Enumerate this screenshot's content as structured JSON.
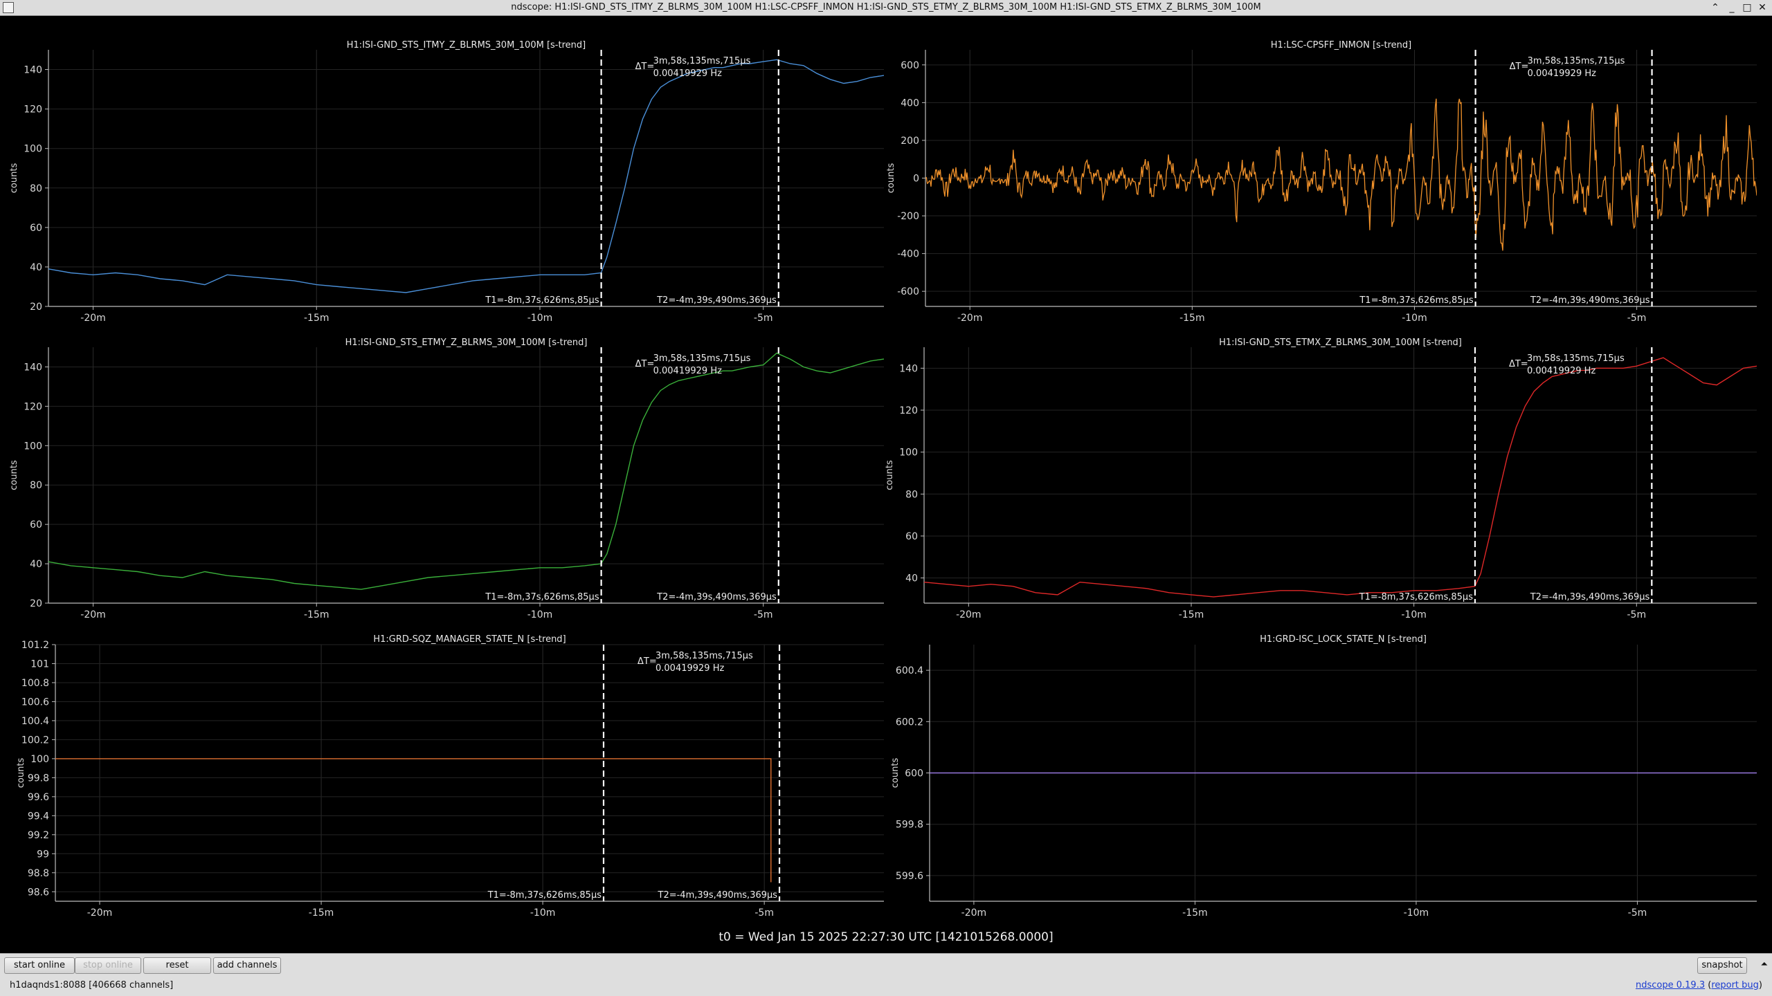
{
  "window": {
    "title": "ndscope: H1:ISI-GND_STS_ITMY_Z_BLRMS_30M_100M H1:LSC-CPSFF_INMON H1:ISI-GND_STS_ETMY_Z_BLRMS_30M_100M H1:ISI-GND_STS_ETMX_Z_BLRMS_30M_100M",
    "minimize": "_",
    "maximize": "□",
    "close": "✕"
  },
  "cursor": {
    "dt_prefix": "ΔT=",
    "dt": "3m,58s,135ms,715μs",
    "freq": "0.00419929 Hz",
    "t1_label": "T1=-8m,37s,626ms,85μs",
    "t2_label": "T2=-4m,39s,490ms,369μs",
    "t1_min": -8.627,
    "t2_min": -4.658
  },
  "colors": {
    "itmy": "#4a8fd8",
    "cpsff": "#f0912a",
    "etmy": "#3ab03a",
    "etmx": "#e02828",
    "sqz": "#e07030",
    "isc": "#9878e0",
    "cursor": "#ffffff"
  },
  "x_ticks": [
    {
      "v": -20,
      "label": "-20m"
    },
    {
      "v": -15,
      "label": "-15m"
    },
    {
      "v": -10,
      "label": "-10m"
    },
    {
      "v": -5,
      "label": "-5m"
    }
  ],
  "plots": [
    {
      "name": "plot-itmy",
      "title": "H1:ISI-GND_STS_ITMY_Z_BLRMS_30M_100M [s-trend]",
      "ylabel": "counts",
      "color_key": "itmy",
      "ylim": [
        20,
        150
      ],
      "ticks": [
        20,
        40,
        60,
        80,
        100,
        120,
        140
      ],
      "cursors": true
    },
    {
      "name": "plot-cpsff",
      "title": "H1:LSC-CPSFF_INMON [s-trend]",
      "ylabel": "counts",
      "color_key": "cpsff",
      "ylim": [
        -680,
        680
      ],
      "ticks": [
        -600,
        -400,
        -200,
        0,
        200,
        400,
        600
      ],
      "cursors": true
    },
    {
      "name": "plot-etmy",
      "title": "H1:ISI-GND_STS_ETMY_Z_BLRMS_30M_100M [s-trend]",
      "ylabel": "counts",
      "color_key": "etmy",
      "ylim": [
        20,
        150
      ],
      "ticks": [
        20,
        40,
        60,
        80,
        100,
        120,
        140
      ],
      "cursors": true
    },
    {
      "name": "plot-etmx",
      "title": "H1:ISI-GND_STS_ETMX_Z_BLRMS_30M_100M [s-trend]",
      "ylabel": "counts",
      "color_key": "etmx",
      "ylim": [
        28,
        150
      ],
      "ticks": [
        40,
        60,
        80,
        100,
        120,
        140
      ],
      "cursors": true
    },
    {
      "name": "plot-sqz",
      "title": "H1:GRD-SQZ_MANAGER_STATE_N [s-trend]",
      "ylabel": "counts",
      "color_key": "sqz",
      "ylim": [
        98.5,
        101.2
      ],
      "ticks": [
        98.6,
        98.8,
        99,
        99.2,
        99.4,
        99.6,
        99.8,
        100,
        100.2,
        100.4,
        100.6,
        100.8,
        101,
        101.2
      ],
      "cursors": true
    },
    {
      "name": "plot-isc",
      "title": "H1:GRD-ISC_LOCK_STATE_N [s-trend]",
      "ylabel": "counts",
      "color_key": "isc",
      "ylim": [
        599.5,
        600.5
      ],
      "ticks": [
        599.6,
        599.8,
        600,
        600.2,
        600.4
      ],
      "cursors": false
    }
  ],
  "chart_data": [
    {
      "type": "line",
      "title": "H1:ISI-GND_STS_ITMY_Z_BLRMS_30M_100M [s-trend]",
      "ylabel": "counts",
      "xlim": [
        -21,
        -2.3
      ],
      "ylim": [
        20,
        150
      ],
      "x": [
        -21,
        -20.5,
        -20,
        -19.5,
        -19,
        -18.5,
        -18,
        -17.5,
        -17,
        -16.5,
        -16,
        -15.5,
        -15,
        -14.5,
        -14,
        -13.5,
        -13,
        -12.5,
        -12,
        -11.5,
        -11,
        -10.5,
        -10,
        -9.5,
        -9,
        -8.63,
        -8.5,
        -8.3,
        -8.1,
        -7.9,
        -7.7,
        -7.5,
        -7.3,
        -7.1,
        -6.9,
        -6.7,
        -6.5,
        -6.3,
        -6.1,
        -5.9,
        -5.7,
        -5.5,
        -5.3,
        -5,
        -4.7,
        -4.4,
        -4.1,
        -3.8,
        -3.5,
        -3.2,
        -2.9,
        -2.6,
        -2.3
      ],
      "series": [
        {
          "values": [
            39,
            37,
            36,
            37,
            36,
            34,
            33,
            31,
            36,
            35,
            34,
            33,
            31,
            30,
            29,
            28,
            27,
            29,
            31,
            33,
            34,
            35,
            36,
            36,
            36,
            37,
            45,
            62,
            80,
            100,
            115,
            125,
            131,
            134,
            136,
            138,
            139,
            140,
            141,
            141,
            142,
            143,
            143,
            144,
            145,
            143,
            142,
            138,
            135,
            133,
            134,
            136,
            137
          ]
        }
      ]
    },
    {
      "type": "line",
      "title": "H1:LSC-CPSFF_INMON [s-trend]",
      "ylabel": "counts",
      "xlim": [
        -21,
        -2.3
      ],
      "ylim": [
        -680,
        680
      ],
      "x": [
        -21,
        -20.5,
        -20,
        -19.5,
        -19,
        -18.5,
        -18,
        -17.5,
        -17,
        -16.5,
        -16,
        -15.5,
        -15,
        -14.5,
        -14,
        -13.5,
        -13,
        -12.5,
        -12,
        -11.5,
        -11,
        -10.5,
        -10,
        -9.5,
        -9,
        -8.5,
        -8,
        -7.5,
        -7,
        -6.5,
        -6,
        -5.5,
        -5,
        -4.5,
        -4,
        -3.5,
        -3,
        -2.5
      ],
      "series": [
        {
          "values": [
            0,
            -80,
            60,
            -100,
            120,
            -50,
            80,
            -120,
            90,
            -60,
            150,
            -120,
            110,
            -80,
            180,
            -160,
            200,
            -140,
            180,
            -220,
            280,
            -260,
            320,
            -380,
            440,
            -500,
            420,
            -360,
            460,
            -380,
            440,
            -420,
            360,
            -300,
            400,
            -280,
            300,
            -250
          ]
        }
      ]
    },
    {
      "type": "line",
      "title": "H1:ISI-GND_STS_ETMY_Z_BLRMS_30M_100M [s-trend]",
      "ylabel": "counts",
      "xlim": [
        -21,
        -2.3
      ],
      "ylim": [
        20,
        150
      ],
      "x": [
        -21,
        -20.5,
        -20,
        -19.5,
        -19,
        -18.5,
        -18,
        -17.5,
        -17,
        -16.5,
        -16,
        -15.5,
        -15,
        -14.5,
        -14,
        -13.5,
        -13,
        -12.5,
        -12,
        -11.5,
        -11,
        -10.5,
        -10,
        -9.5,
        -9,
        -8.63,
        -8.5,
        -8.3,
        -8.1,
        -7.9,
        -7.7,
        -7.5,
        -7.3,
        -7.1,
        -6.9,
        -6.7,
        -6.5,
        -6.3,
        -6.1,
        -5.9,
        -5.7,
        -5.5,
        -5.3,
        -5,
        -4.7,
        -4.4,
        -4.1,
        -3.8,
        -3.5,
        -3.2,
        -2.9,
        -2.6,
        -2.3
      ],
      "series": [
        {
          "values": [
            41,
            39,
            38,
            37,
            36,
            34,
            33,
            36,
            34,
            33,
            32,
            30,
            29,
            28,
            27,
            29,
            31,
            33,
            34,
            35,
            36,
            37,
            38,
            38,
            39,
            40,
            45,
            60,
            80,
            100,
            113,
            122,
            128,
            131,
            133,
            134,
            135,
            136,
            137,
            138,
            138,
            139,
            140,
            141,
            147,
            144,
            140,
            138,
            137,
            139,
            141,
            143,
            144
          ]
        }
      ]
    },
    {
      "type": "line",
      "title": "H1:ISI-GND_STS_ETMX_Z_BLRMS_30M_100M [s-trend]",
      "ylabel": "counts",
      "xlim": [
        -21,
        -2.3
      ],
      "ylim": [
        28,
        150
      ],
      "x": [
        -21,
        -20.5,
        -20,
        -19.5,
        -19,
        -18.5,
        -18,
        -17.5,
        -17,
        -16.5,
        -16,
        -15.5,
        -15,
        -14.5,
        -14,
        -13.5,
        -13,
        -12.5,
        -12,
        -11.5,
        -11,
        -10.5,
        -10,
        -9.5,
        -9,
        -8.63,
        -8.5,
        -8.3,
        -8.1,
        -7.9,
        -7.7,
        -7.5,
        -7.3,
        -7.1,
        -6.9,
        -6.7,
        -6.5,
        -6.3,
        -6.1,
        -5.9,
        -5.7,
        -5.5,
        -5.3,
        -5,
        -4.7,
        -4.4,
        -4.1,
        -3.8,
        -3.5,
        -3.2,
        -2.9,
        -2.6,
        -2.3
      ],
      "series": [
        {
          "values": [
            38,
            37,
            36,
            37,
            36,
            33,
            32,
            38,
            37,
            36,
            35,
            33,
            32,
            31,
            32,
            33,
            34,
            34,
            33,
            32,
            33,
            33,
            34,
            34,
            35,
            36,
            42,
            60,
            80,
            98,
            112,
            122,
            129,
            133,
            136,
            137,
            138,
            139,
            139,
            140,
            140,
            140,
            140,
            141,
            143,
            145,
            141,
            137,
            133,
            132,
            136,
            140,
            141
          ]
        }
      ]
    },
    {
      "type": "line",
      "title": "H1:GRD-SQZ_MANAGER_STATE_N [s-trend]",
      "ylabel": "counts",
      "xlim": [
        -21,
        -2.3
      ],
      "ylim": [
        98.5,
        101.2
      ],
      "x": [
        -21,
        -4.85,
        -4.85
      ],
      "series": [
        {
          "values": [
            100,
            100,
            98.7
          ]
        }
      ]
    },
    {
      "type": "line",
      "title": "H1:GRD-ISC_LOCK_STATE_N [s-trend]",
      "ylabel": "counts",
      "xlim": [
        -21,
        -2.3
      ],
      "ylim": [
        599.5,
        600.5
      ],
      "x": [
        -21,
        -2.3
      ],
      "series": [
        {
          "values": [
            600,
            600
          ]
        }
      ]
    }
  ],
  "t0_label": "t0 = Wed Jan 15 2025 22:27:30 UTC [1421015268.0000]",
  "buttons": {
    "start_online": "start online",
    "stop_online": "stop online",
    "reset": "reset",
    "add_channels": "add channels",
    "snapshot": "snapshot"
  },
  "status": {
    "server": "h1daqnds1:8088",
    "channels": "[406668 channels]"
  },
  "version": {
    "link": "ndscope 0.19.3",
    "report_bug": "report bug"
  }
}
